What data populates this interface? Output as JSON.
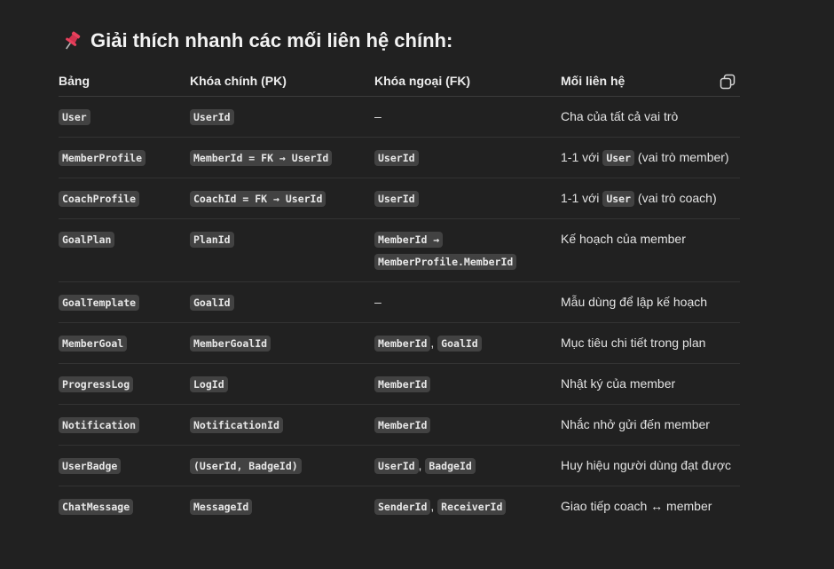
{
  "heading": {
    "icon": "pushpin-icon",
    "text": "Giải thích nhanh các mối liên hệ chính:"
  },
  "table": {
    "headers": [
      "Bảng",
      "Khóa chính (PK)",
      "Khóa ngoại (FK)",
      "Mối liên hệ"
    ],
    "copy_icon": "copy-icon",
    "rows": [
      {
        "table": "User",
        "pk": "UserId",
        "fk": "–",
        "relation": "Cha của tất cả vai trò"
      },
      {
        "table": "MemberProfile",
        "pk": "MemberId = FK → UserId",
        "fk": "UserId",
        "relation_pre": "1-1 với",
        "relation_code": "User",
        "relation_post": "(vai trò member)"
      },
      {
        "table": "CoachProfile",
        "pk": "CoachId = FK → UserId",
        "fk": "UserId",
        "relation_pre": "1-1 với",
        "relation_code": "User",
        "relation_post": "(vai trò coach)"
      },
      {
        "table": "GoalPlan",
        "pk": "PlanId",
        "fk_line1": "MemberId →",
        "fk_line2": "MemberProfile.MemberId",
        "relation": "Kế hoạch của member"
      },
      {
        "table": "GoalTemplate",
        "pk": "GoalId",
        "fk": "–",
        "relation": "Mẫu dùng để lập kế hoạch"
      },
      {
        "table": "MemberGoal",
        "pk": "MemberGoalId",
        "fk_a": "MemberId",
        "fk_b": "GoalId",
        "relation": "Mục tiêu chi tiết trong plan"
      },
      {
        "table": "ProgressLog",
        "pk": "LogId",
        "fk": "MemberId",
        "relation": "Nhật ký của member"
      },
      {
        "table": "Notification",
        "pk": "NotificationId",
        "fk": "MemberId",
        "relation": "Nhắc nhở gửi đến member"
      },
      {
        "table": "UserBadge",
        "pk": "(UserId, BadgeId)",
        "fk_a": "UserId",
        "fk_b": "BadgeId",
        "relation": "Huy hiệu người dùng đạt được"
      },
      {
        "table": "ChatMessage",
        "pk": "MessageId",
        "fk_a": "SenderId",
        "fk_b": "ReceiverId",
        "relation": "Giao tiếp coach ↔ member"
      }
    ],
    "separator": ","
  },
  "colors": {
    "background": "#212121",
    "code_bg": "#424242",
    "text": "#ececec",
    "pin": "#e8405c"
  }
}
